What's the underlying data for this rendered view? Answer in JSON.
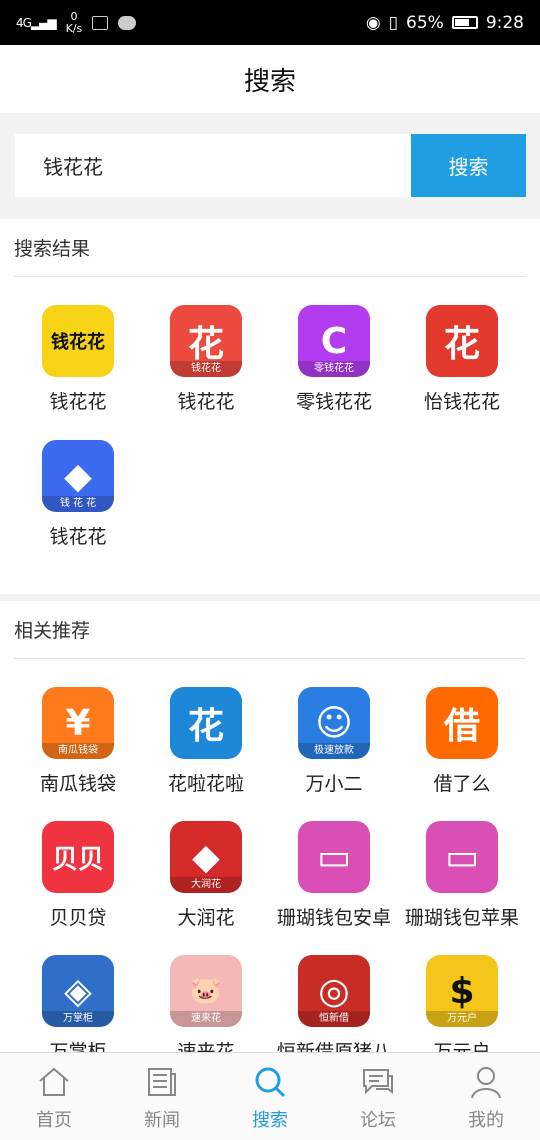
{
  "status": {
    "network": "4G",
    "speed_value": "0",
    "speed_unit": "K/s",
    "battery": "65%",
    "time": "9:28"
  },
  "header": {
    "title": "搜索"
  },
  "search": {
    "value": "钱花花",
    "button_label": "搜索"
  },
  "results": {
    "title": "搜索结果",
    "apps": [
      {
        "name": "钱花花",
        "icon": "qianhuahua-yellow-icon",
        "icon_text": "钱花花",
        "color": "#f7d316"
      },
      {
        "name": "钱花花",
        "icon": "hua-red-icon",
        "icon_text": "花",
        "sub_text": "钱花花",
        "color": "#ec4a3f"
      },
      {
        "name": "零钱花花",
        "icon": "lingqian-purple-icon",
        "icon_text": "C",
        "sub_text": "零钱花花",
        "color": "#b43cf0"
      },
      {
        "name": "怡钱花花",
        "icon": "hua-red-stylized-icon",
        "icon_text": "花",
        "color": "#e33a2d"
      },
      {
        "name": "钱花花",
        "icon": "qianhuahua-blue-icon",
        "icon_text": "◆",
        "sub_text": "钱 花 花",
        "color": "#3d6bf0"
      }
    ]
  },
  "recommend": {
    "title": "相关推荐",
    "apps": [
      {
        "name": "南瓜钱袋",
        "icon": "money-bag-icon",
        "icon_text": "¥",
        "sub_text": "南瓜钱袋",
        "color": "#ff7a1a"
      },
      {
        "name": "花啦花啦",
        "icon": "hua-blue-circle-icon",
        "icon_text": "花",
        "color": "#1e88d8"
      },
      {
        "name": "万小二",
        "icon": "mascot-blue-icon",
        "icon_text": "☺",
        "sub_text": "极速放款",
        "color": "#2a7de1"
      },
      {
        "name": "借了么",
        "icon": "jie-orange-icon",
        "icon_text": "借",
        "color": "#ff6a00"
      },
      {
        "name": "贝贝贷",
        "icon": "beibei-red-icon",
        "icon_text": "贝贝",
        "color": "#ef3340"
      },
      {
        "name": "大润花",
        "icon": "darunhua-red-icon",
        "icon_text": "◆",
        "sub_text": "大润花",
        "color": "#d62a2a"
      },
      {
        "name": "珊瑚钱包安卓",
        "icon": "wallet-pink-icon",
        "icon_text": "▭",
        "color": "#d94fb5"
      },
      {
        "name": "珊瑚钱包苹果",
        "icon": "wallet-pink-icon",
        "icon_text": "▭",
        "color": "#d94fb5"
      },
      {
        "name": "万掌柜",
        "icon": "wanzhanggui-blue-icon",
        "icon_text": "◈",
        "sub_text": "万掌柜",
        "color": "#2f6fc9"
      },
      {
        "name": "速来花",
        "icon": "pig-icon",
        "icon_text": "🐷",
        "sub_text": "速来花",
        "color": "#f5b8b8"
      },
      {
        "name": "恒新借原猪八",
        "icon": "hengxin-red-icon",
        "icon_text": "◎",
        "sub_text": "恒新借",
        "color": "#c92b25"
      },
      {
        "name": "万元户",
        "icon": "wanyuanhu-yellow-icon",
        "icon_text": "$",
        "sub_text": "万元户",
        "color": "#f5c51a"
      }
    ]
  },
  "nav": {
    "items": [
      {
        "label": "首页",
        "icon": "home-icon"
      },
      {
        "label": "新闻",
        "icon": "news-icon"
      },
      {
        "label": "搜索",
        "icon": "search-icon"
      },
      {
        "label": "论坛",
        "icon": "forum-icon"
      },
      {
        "label": "我的",
        "icon": "profile-icon"
      }
    ]
  }
}
